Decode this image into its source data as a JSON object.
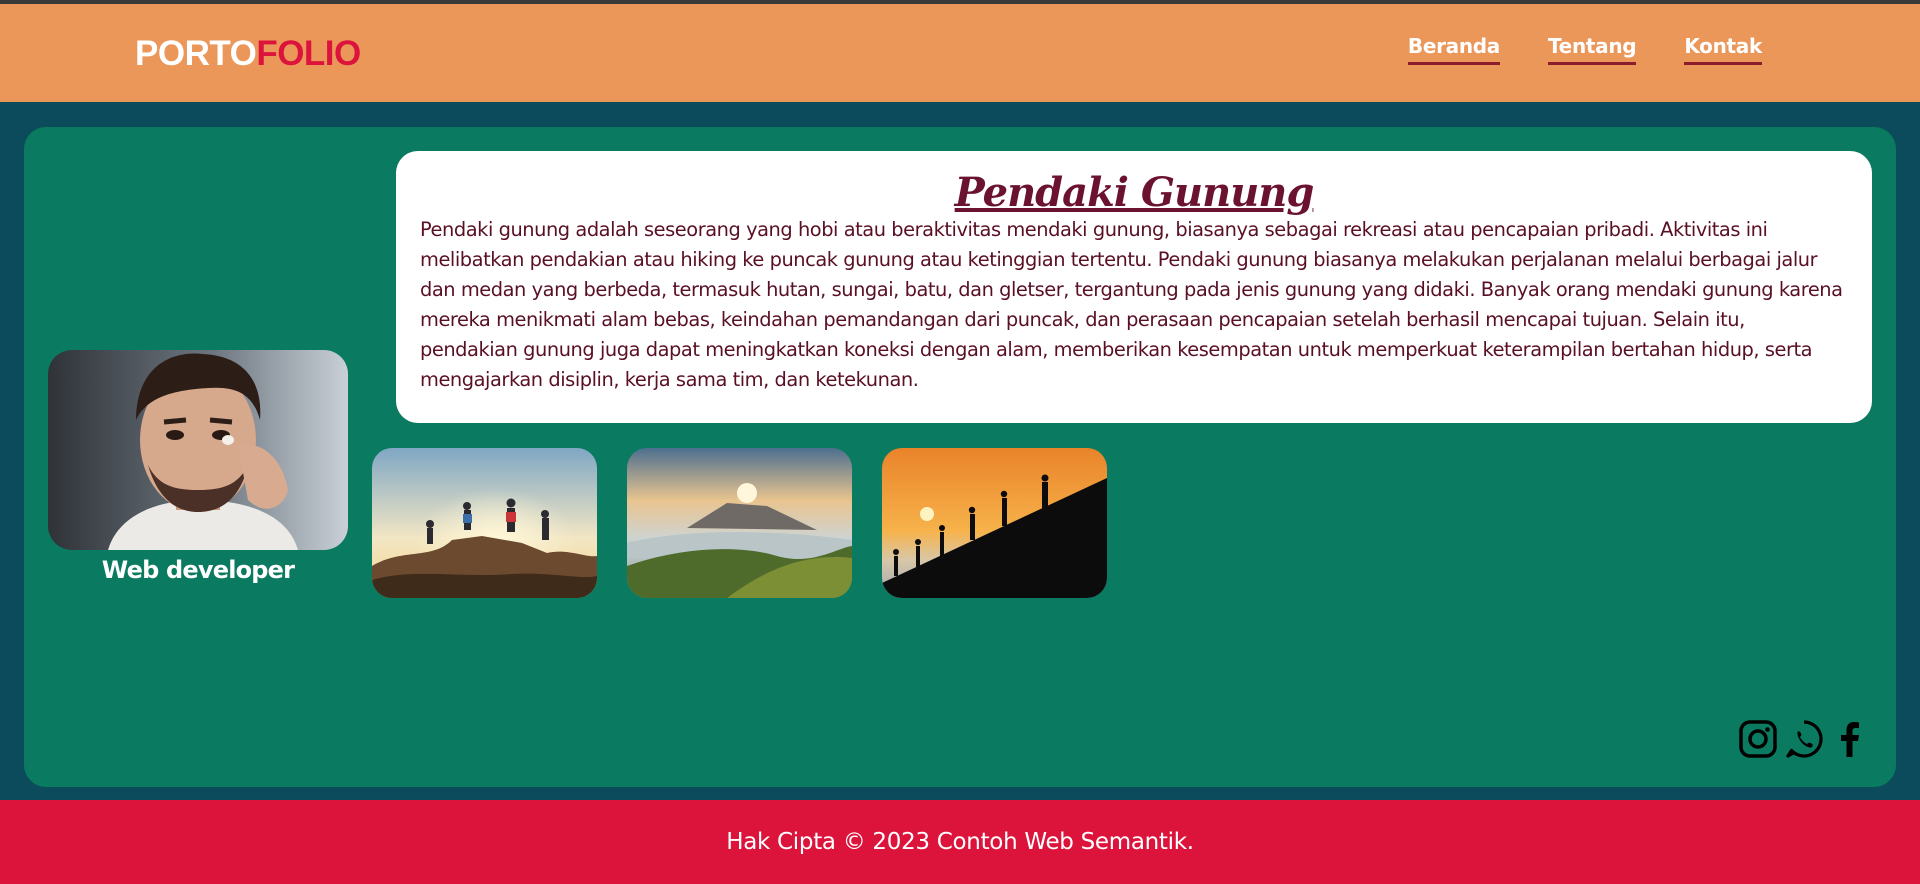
{
  "header": {
    "logo_part1": "PORTO",
    "logo_part2": "FOLIO",
    "nav": [
      {
        "label": "Beranda"
      },
      {
        "label": "Tentang"
      },
      {
        "label": "Kontak"
      }
    ]
  },
  "profile": {
    "role": "Web developer"
  },
  "article": {
    "title": "Pendaki Gunung",
    "body": "Pendaki gunung adalah seseorang yang hobi atau beraktivitas mendaki gunung, biasanya sebagai rekreasi atau pencapaian pribadi. Aktivitas ini melibatkan pendakian atau hiking ke puncak gunung atau ketinggian tertentu. Pendaki gunung biasanya melakukan perjalanan melalui berbagai jalur dan medan yang berbeda, termasuk hutan, sungai, batu, dan gletser, tergantung pada jenis gunung yang didaki. Banyak orang mendaki gunung karena mereka menikmati alam bebas, keindahan pemandangan dari puncak, dan perasaan pencapaian setelah berhasil mencapai tujuan. Selain itu, pendakian gunung juga dapat meningkatkan koneksi dengan alam, memberikan kesempatan untuk memperkuat keterampilan bertahan hidup, serta mengajarkan disiplin, kerja sama tim, dan ketekunan."
  },
  "social_icons": [
    "instagram-icon",
    "whatsapp-icon",
    "facebook-icon"
  ],
  "footer": {
    "text": "Hak Cipta © 2023 Contoh Web Semantik."
  },
  "colors": {
    "header_bg": "#eb975a",
    "page_bg": "#0b4b5c",
    "main_bg": "#0a7a60",
    "accent": "#dc143c",
    "title": "#6b1230"
  }
}
